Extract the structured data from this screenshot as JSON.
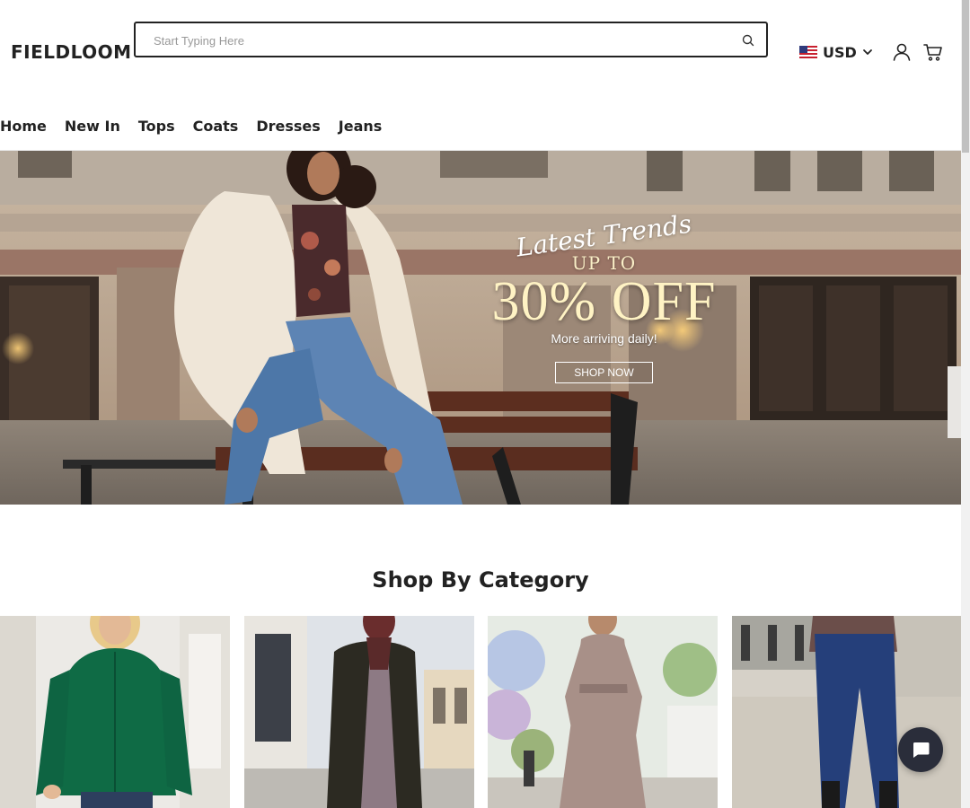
{
  "header": {
    "brand": "FIELDLOOM",
    "search": {
      "placeholder": "Start Typing Here",
      "value": ""
    },
    "currency": {
      "label": "USD",
      "flag_icon": "us-flag-icon"
    },
    "icons": [
      "search-icon",
      "user-account-icon",
      "shopping-cart-icon",
      "chevron-down-icon"
    ]
  },
  "nav": {
    "items": [
      {
        "label": "Home"
      },
      {
        "label": "New In"
      },
      {
        "label": "Tops"
      },
      {
        "label": "Coats"
      },
      {
        "label": "Dresses"
      },
      {
        "label": "Jeans"
      }
    ]
  },
  "hero": {
    "script": "Latest Trends",
    "upto": "UP TO",
    "discount": "30% OFF",
    "subtitle": "More arriving daily!",
    "cta": "SHOP NOW"
  },
  "categories": {
    "title": "Shop By Category",
    "cards": [
      "cardigan-photo",
      "coat-photo",
      "dress-photo",
      "jeans-photo"
    ]
  },
  "chat": {
    "icon": "chat-bubble-icon"
  },
  "colors": {
    "text": "#222222",
    "hero_text": "#fff3c4",
    "chat_button": "#2a2d3a"
  }
}
